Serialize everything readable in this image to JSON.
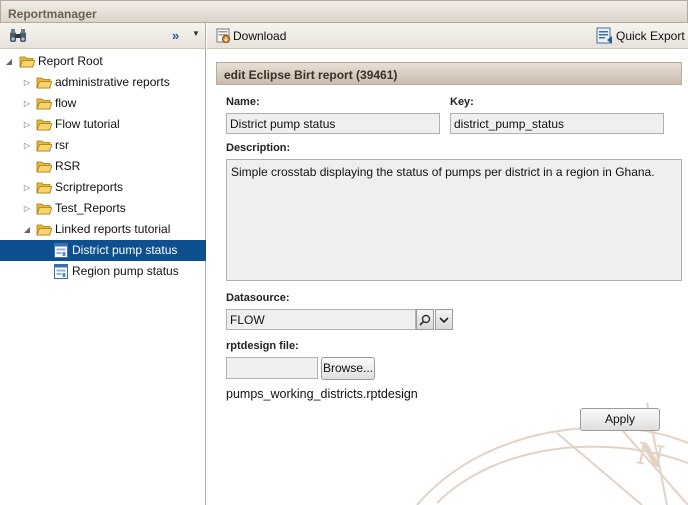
{
  "app": {
    "title": "Reportmanager"
  },
  "left_toolbar": {
    "icons": [
      "binoculars-icon",
      "expand-all-icon",
      "chevron-down-icon"
    ]
  },
  "tree": {
    "root": {
      "label": "Report Root",
      "icon": "folder-open-icon"
    },
    "items": [
      {
        "label": "administrative reports",
        "icon": "folder-icon",
        "expandable": true
      },
      {
        "label": "flow",
        "icon": "folder-icon",
        "expandable": true
      },
      {
        "label": "Flow tutorial",
        "icon": "folder-icon",
        "expandable": true
      },
      {
        "label": "rsr",
        "icon": "folder-icon",
        "expandable": true
      },
      {
        "label": "RSR",
        "icon": "folder-icon",
        "expandable": false
      },
      {
        "label": "Scriptreports",
        "icon": "folder-icon",
        "expandable": true
      },
      {
        "label": "Test_Reports",
        "icon": "folder-icon",
        "expandable": true
      },
      {
        "label": "Linked reports tutorial",
        "icon": "folder-open-icon",
        "expandable": true,
        "expanded": true
      }
    ],
    "children": [
      {
        "label": "District pump status",
        "icon": "report-icon",
        "selected": true
      },
      {
        "label": "Region pump status",
        "icon": "report-icon",
        "selected": false
      }
    ]
  },
  "right_toolbar": {
    "download_label": "Download",
    "quick_export_label": "Quick Export"
  },
  "form": {
    "header": "edit Eclipse Birt report (39461)",
    "name_label": "Name:",
    "name_value": "District pump status",
    "key_label": "Key:",
    "key_value": "district_pump_status",
    "description_label": "Description:",
    "description_value": "Simple crosstab displaying the status of pumps per district in a region in Ghana.",
    "datasource_label": "Datasource:",
    "datasource_value": "FLOW",
    "rptdesign_label": "rptdesign file:",
    "file_value": "",
    "browse_label": "Browse...",
    "filename": "pumps_working_districts.rptdesign",
    "apply_label": "Apply"
  },
  "colors": {
    "selection": "#0d4f8f",
    "title_text": "#6b5f53",
    "panel_header": "#c9bcae",
    "watermark": "#e4d2c4"
  }
}
